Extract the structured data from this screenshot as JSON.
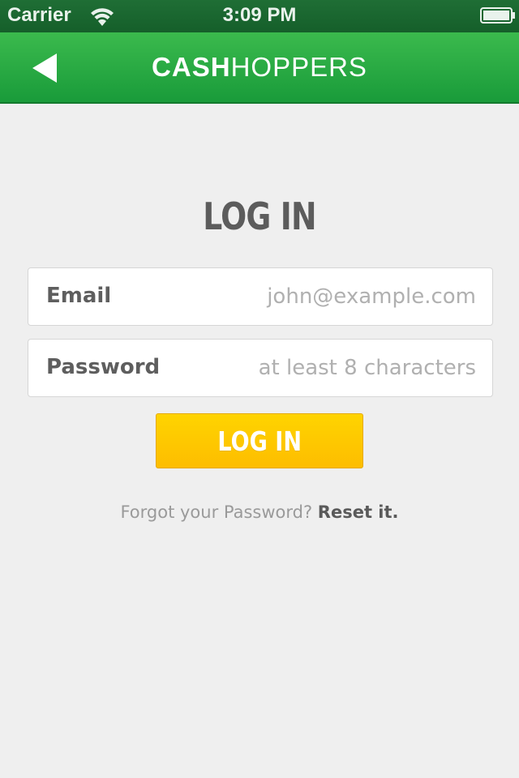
{
  "status_bar": {
    "carrier": "Carrier",
    "time": "3:09 PM"
  },
  "nav": {
    "brand_bold": "CASH",
    "brand_light": "HOPPERS",
    "back_icon": "back-arrow-icon"
  },
  "page": {
    "title": "LOG IN"
  },
  "form": {
    "email_label": "Email",
    "email_placeholder": "john@example.com",
    "email_value": "",
    "password_label": "Password",
    "password_placeholder": "at least 8 characters",
    "password_value": "",
    "submit_label": "LOG IN"
  },
  "forgot": {
    "text": "Forgot your Password?",
    "link_label": "Reset it."
  },
  "colors": {
    "nav_green": "#2aa845",
    "button_yellow": "#ffcc00",
    "background": "#efefef",
    "text_gray": "#5e5e5e",
    "placeholder_gray": "#b0b0b0"
  }
}
